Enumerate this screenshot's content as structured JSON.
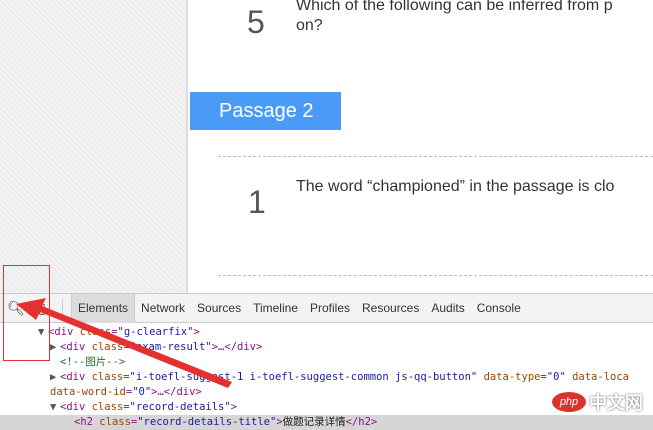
{
  "questions": [
    {
      "number": "5",
      "text_line1": "Which of the following can be inferred from p",
      "text_line2": "on?"
    },
    {
      "number": "1",
      "text": "The word “championed” in the passage is clo"
    }
  ],
  "passage_label": "Passage 2",
  "devtools": {
    "tabs": [
      "Elements",
      "Network",
      "Sources",
      "Timeline",
      "Profiles",
      "Resources",
      "Audits",
      "Console"
    ],
    "active_tab": "Elements",
    "code": {
      "l1_tag_open": "<div ",
      "l1_attr": "class",
      "l1_val": "\"g-clearfix\"",
      "l1_close": ">",
      "l2_val": "\"exam-result\"",
      "l2_rest": ">…</div>",
      "l3_comment": "<!--图片-->",
      "l4_val": "\"i-toefl-suggest-1 i-toefl-suggest-common js-qq-button\"",
      "l4_attr2": "data-type",
      "l4_val2": "\"0\"",
      "l4_attr3": "data-loca",
      "l5_attr": "data-word-id",
      "l5_val": "\"0\"",
      "l5_rest": ">…</div>",
      "l6_val": "\"record-details\"",
      "l7_val": "\"record-details-title\"",
      "l7_text": "做题记录详情",
      "l7_close": "</h2>"
    }
  },
  "watermark": {
    "php": "php",
    "cn": "中文网"
  }
}
